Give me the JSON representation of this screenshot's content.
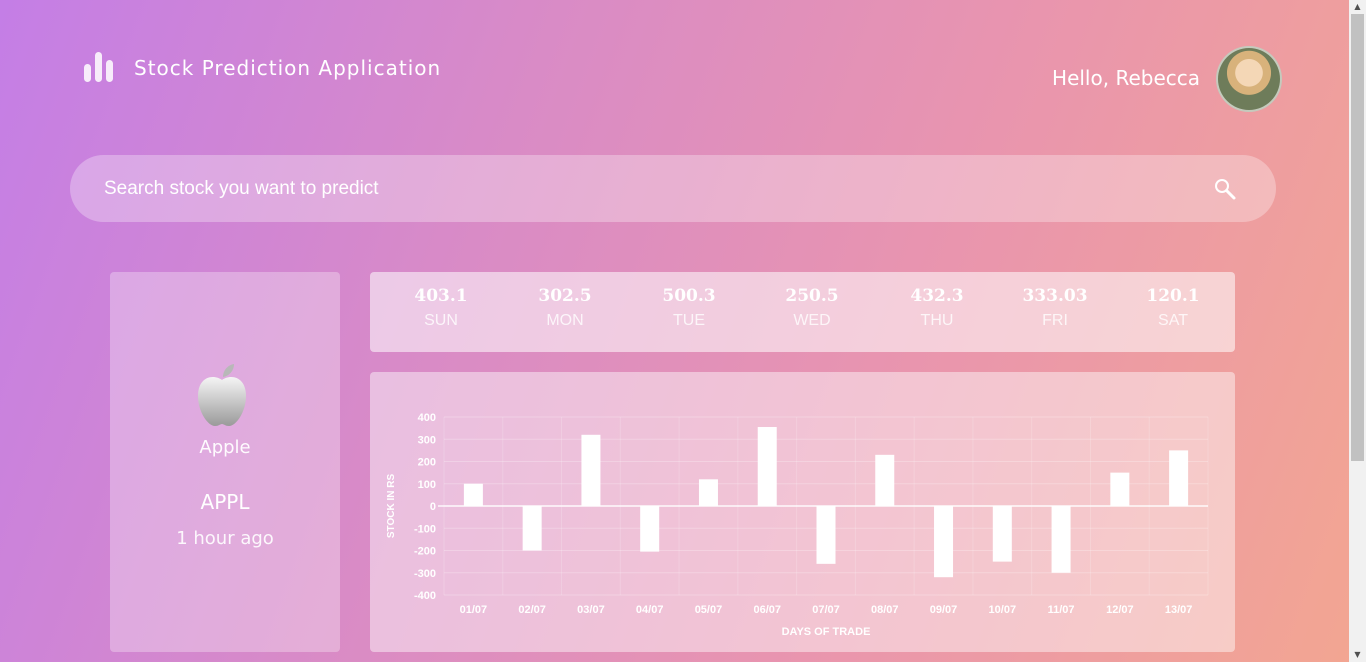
{
  "header": {
    "app_title": "Stock Prediction Application",
    "greeting": "Hello, Rebecca"
  },
  "search": {
    "placeholder": "Search stock you want to predict"
  },
  "stock": {
    "company": "Apple",
    "ticker": "APPL",
    "updated": "1 hour ago"
  },
  "week": [
    {
      "value": "403.1",
      "day": "SUN"
    },
    {
      "value": "302.5",
      "day": "MON"
    },
    {
      "value": "500.3",
      "day": "TUE"
    },
    {
      "value": "250.5",
      "day": "WED"
    },
    {
      "value": "432.3",
      "day": "THU"
    },
    {
      "value": "333.03",
      "day": "FRI"
    },
    {
      "value": "120.1",
      "day": "SAT"
    }
  ],
  "chart_data": {
    "type": "bar",
    "categories": [
      "01/07",
      "02/07",
      "03/07",
      "04/07",
      "05/07",
      "06/07",
      "07/07",
      "08/07",
      "09/07",
      "10/07",
      "11/07",
      "12/07",
      "13/07"
    ],
    "values": [
      100,
      -200,
      320,
      -205,
      120,
      355,
      -260,
      230,
      -320,
      -250,
      -300,
      150,
      250
    ],
    "yticks": [
      400,
      300,
      200,
      100,
      0,
      -100,
      -200,
      -300,
      -400
    ],
    "ylim": [
      -400,
      400
    ],
    "xlabel": "DAYS OF TRADE",
    "ylabel": "STOCK IN RS",
    "grid": true,
    "bar_color": "#ffffff"
  },
  "colors": {
    "bg_start": "#c47ee6",
    "bg_end": "#f3a691"
  }
}
